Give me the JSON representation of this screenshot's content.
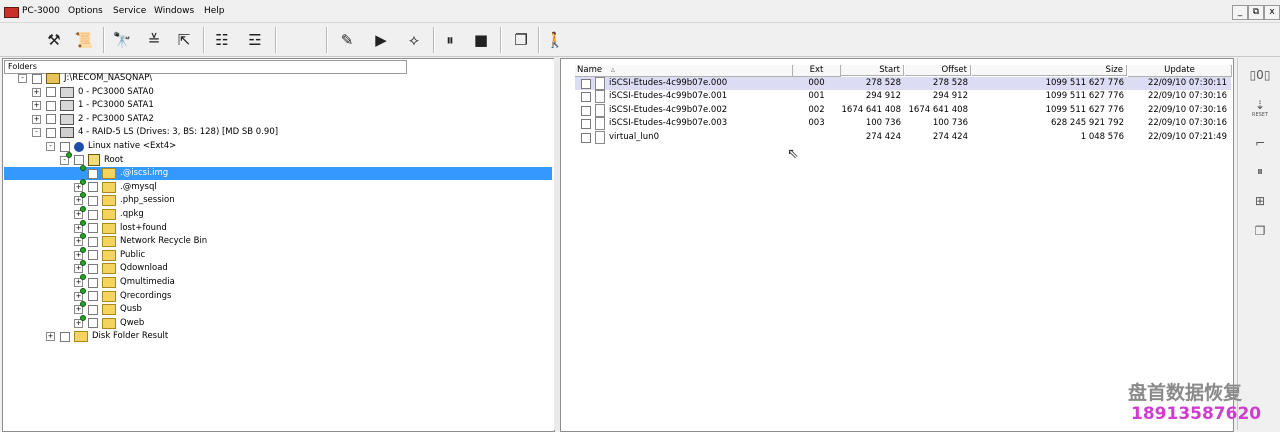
{
  "app": {
    "title": "PC-3000"
  },
  "menu": [
    "Options",
    "Service",
    "Windows",
    "Help"
  ],
  "window_buttons": [
    "_",
    "⧉",
    "x"
  ],
  "toolbar": [
    {
      "name": "tools-icon",
      "glyph": "⚒"
    },
    {
      "name": "scroll-icon",
      "glyph": "📜"
    },
    {
      "name": "binoculars-icon",
      "glyph": "🔭"
    },
    {
      "name": "sort-icon",
      "glyph": "≚"
    },
    {
      "name": "export-icon",
      "glyph": "⇱"
    },
    {
      "name": "tree-list-icon",
      "glyph": "☷"
    },
    {
      "name": "tree-copy-icon",
      "glyph": "☲"
    },
    {
      "name": "edit-doc-icon",
      "glyph": "✎"
    },
    {
      "name": "play-icon",
      "glyph": "▶"
    },
    {
      "name": "network-icon",
      "glyph": "⟡"
    },
    {
      "name": "pause-icon",
      "glyph": "⏸"
    },
    {
      "name": "stop-icon",
      "glyph": "■"
    },
    {
      "name": "windows-icon",
      "glyph": "❐"
    },
    {
      "name": "exit-icon",
      "glyph": "🚶"
    }
  ],
  "folders_panel": {
    "header": "Folders",
    "tree": [
      {
        "indent": 0,
        "pm": "−",
        "icon": "drive",
        "label": "J:\\RECOM_NASQNAP\\"
      },
      {
        "indent": 1,
        "pm": "+",
        "icon": "disk",
        "label": "0 - PC3000 SATA0"
      },
      {
        "indent": 1,
        "pm": "+",
        "icon": "disk",
        "label": "1 - PC3000 SATA1"
      },
      {
        "indent": 1,
        "pm": "+",
        "icon": "disk",
        "label": "2 - PC3000 SATA2"
      },
      {
        "indent": 1,
        "pm": "−",
        "icon": "raid",
        "label": "4 - RAID-5 LS (Drives: 3, BS: 128) [MD SB 0.90]"
      },
      {
        "indent": 2,
        "pm": "−",
        "icon": "info",
        "label": "Linux native <Ext4>"
      },
      {
        "indent": 3,
        "pm": "−",
        "icon": "root",
        "label": "Root"
      },
      {
        "indent": 4,
        "pm": "",
        "icon": "folder",
        "label": ".@iscsi.img",
        "selected": true
      },
      {
        "indent": 4,
        "pm": "+",
        "icon": "folder",
        "label": ".@mysql"
      },
      {
        "indent": 4,
        "pm": "+",
        "icon": "folder",
        "label": ".php_session"
      },
      {
        "indent": 4,
        "pm": "+",
        "icon": "folder",
        "label": ".qpkg"
      },
      {
        "indent": 4,
        "pm": "+",
        "icon": "folder",
        "label": "lost+found"
      },
      {
        "indent": 4,
        "pm": "+",
        "icon": "folder",
        "label": "Network Recycle Bin"
      },
      {
        "indent": 4,
        "pm": "+",
        "icon": "folder",
        "label": "Public"
      },
      {
        "indent": 4,
        "pm": "+",
        "icon": "folder",
        "label": "Qdownload"
      },
      {
        "indent": 4,
        "pm": "+",
        "icon": "folder",
        "label": "Qmultimedia"
      },
      {
        "indent": 4,
        "pm": "+",
        "icon": "folder",
        "label": "Qrecordings"
      },
      {
        "indent": 4,
        "pm": "+",
        "icon": "folder",
        "label": "Qusb"
      },
      {
        "indent": 4,
        "pm": "+",
        "icon": "folder",
        "label": "Qweb"
      },
      {
        "indent": 2,
        "pm": "+",
        "icon": "folder",
        "label": "Disk Folder Result"
      }
    ]
  },
  "files_panel": {
    "columns": [
      "Name",
      "Ext",
      "Start",
      "Offset",
      "Size",
      "Update"
    ],
    "rows": [
      {
        "name": "iSCSI-Etudes-4c99b07e.000",
        "ext": "000",
        "start": "278 528",
        "offset": "278 528",
        "size": "1099 511 627 776",
        "update": "22/09/10 07:30:11",
        "highlight": true
      },
      {
        "name": "iSCSI-Etudes-4c99b07e.001",
        "ext": "001",
        "start": "294 912",
        "offset": "294 912",
        "size": "1099 511 627 776",
        "update": "22/09/10 07:30:16"
      },
      {
        "name": "iSCSI-Etudes-4c99b07e.002",
        "ext": "002",
        "start": "1674 641 408",
        "offset": "1674 641 408",
        "size": "1099 511 627 776",
        "update": "22/09/10 07:30:16"
      },
      {
        "name": "iSCSI-Etudes-4c99b07e.003",
        "ext": "003",
        "start": "100 736",
        "offset": "100 736",
        "size": "628 245 921 792",
        "update": "22/09/10 07:30:16"
      },
      {
        "name": "virtual_lun0",
        "ext": "",
        "start": "274 424",
        "offset": "274 424",
        "size": "1 048 576",
        "update": "22/09/10 07:21:49"
      }
    ]
  },
  "side_tools": [
    {
      "name": "drive-status-icon",
      "glyph": "▯0▯"
    },
    {
      "name": "reset-icon",
      "glyph": "⇣"
    },
    {
      "name": "branch-icon",
      "glyph": "⌐"
    },
    {
      "name": "pause-side-icon",
      "glyph": "⏸"
    },
    {
      "name": "bus-icon",
      "glyph": "⊞"
    },
    {
      "name": "copy-side-icon",
      "glyph": "❐"
    }
  ],
  "side_reset_label": "RESET",
  "watermark": {
    "line1": "盘首数据恢复",
    "line2": "18913587620"
  }
}
